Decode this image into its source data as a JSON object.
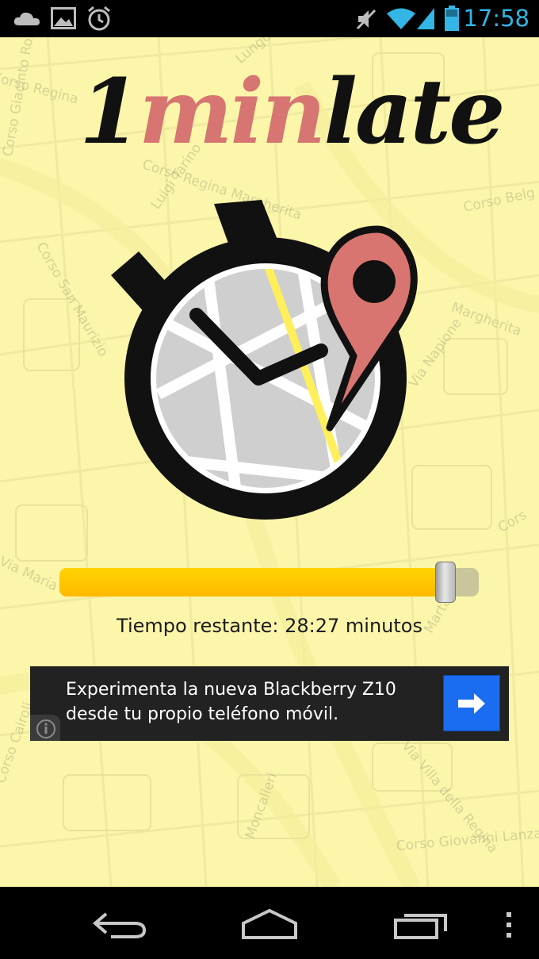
{
  "status_bar": {
    "time": "17:58",
    "icons": [
      "cloud-icon",
      "image-icon",
      "alarm-icon",
      "mute-icon",
      "wifi-icon",
      "signal-icon",
      "battery-icon"
    ],
    "accent": "#33b5e5"
  },
  "app": {
    "logo": {
      "part1": "1",
      "part2": "min",
      "part3": "late"
    },
    "slider": {
      "value_fraction": 0.92
    },
    "time_remaining": "Tiempo restante: 28:27 minutos",
    "map_labels": [
      "Corso Regina Margherita",
      "Corso Regina",
      "Corso Belg",
      "Corso San Maurizio",
      "Via Napione",
      "Corso Cairoli",
      "Corso Giovanni Lanza",
      "Via Villa della Regina",
      "Moncalieri",
      "Margherita",
      "Luigi Tarino",
      "Lungo",
      "Marta Lib",
      "Via Maria",
      "Corso Giacinto Rossi",
      "Cors"
    ],
    "colors": {
      "background": "#fbf6a9",
      "brand_red": "#d77572",
      "slider_fill": "#ffc500"
    }
  },
  "ad": {
    "line1": "Experimenta la nueva Blackberry Z10",
    "line2": "desde tu propio teléfono móvil."
  },
  "nav_bar": {
    "buttons": [
      "back-icon",
      "home-icon",
      "recent-apps-icon",
      "overflow-menu-icon"
    ]
  }
}
